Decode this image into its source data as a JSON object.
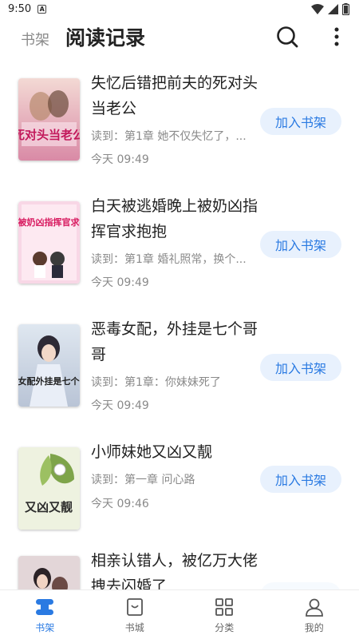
{
  "status": {
    "time": "9:50",
    "notif": "A"
  },
  "header": {
    "tab_shelf": "书架",
    "title": "阅读记录"
  },
  "books": [
    {
      "title": "失忆后错把前夫的死对头当老公",
      "progress": "读到：第1章 她不仅失忆了，...",
      "time": "今天 09:49",
      "action": "加入书架",
      "cover_text": "死对头当老公"
    },
    {
      "title": "白天被逃婚晚上被奶凶指挥官求抱抱",
      "progress": "读到：第1章 婚礼照常，换个...",
      "time": "今天 09:49",
      "action": "加入书架",
      "cover_text": "晚上被奶凶指挥官求抱抱"
    },
    {
      "title": "恶毒女配，外挂是七个哥哥",
      "progress": "读到：第1章：你妹妹死了",
      "time": "今天 09:49",
      "action": "加入书架",
      "cover_text": "恶毒女配外挂是七个哥哥"
    },
    {
      "title": "小师妹她又凶又靓",
      "progress": "读到：第一章 问心路",
      "time": "今天 09:46",
      "action": "加入书架",
      "cover_text": "又凶又靓"
    },
    {
      "title": "相亲认错人，被亿万大佬拽去闪婚了",
      "progress": "",
      "time": "",
      "action": "加入书架",
      "cover_text": ""
    }
  ],
  "tabbar": [
    {
      "label": "书架",
      "icon": "bookshelf-icon",
      "active": true
    },
    {
      "label": "书城",
      "icon": "store-icon",
      "active": false
    },
    {
      "label": "分类",
      "icon": "grid-icon",
      "active": false
    },
    {
      "label": "我的",
      "icon": "profile-icon",
      "active": false
    }
  ],
  "colors": {
    "accent": "#2a7ae2",
    "button_bg": "#e8f1fd",
    "muted": "#8a8a8a"
  }
}
